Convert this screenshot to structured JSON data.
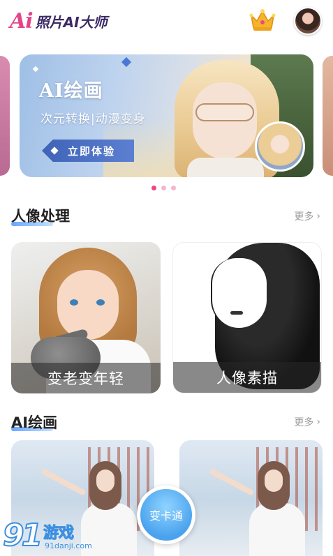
{
  "header": {
    "logo_ai": "Ai",
    "logo_text": "照片AI大师",
    "crown_icon": "crown-icon",
    "avatar_icon": "user-avatar"
  },
  "banner": {
    "title": "AI绘画",
    "subtitle": "次元转换|动漫变身",
    "button": "立即体验",
    "page_indicator": {
      "total": 3,
      "active": 1
    }
  },
  "portrait_section": {
    "title": "人像处理",
    "more": "更多",
    "cards": [
      {
        "label": "变老变年轻"
      },
      {
        "label": "人像素描"
      }
    ]
  },
  "ai_section": {
    "title": "AI绘画",
    "more": "更多"
  },
  "fab": {
    "label": "变卡通"
  },
  "watermark": {
    "number": "91",
    "word": "游戏",
    "url": "91danji.com"
  },
  "colors": {
    "brand_pink": "#e8488b",
    "accent_blue": "#4aa2ee",
    "title_dark": "#3b2a66"
  }
}
